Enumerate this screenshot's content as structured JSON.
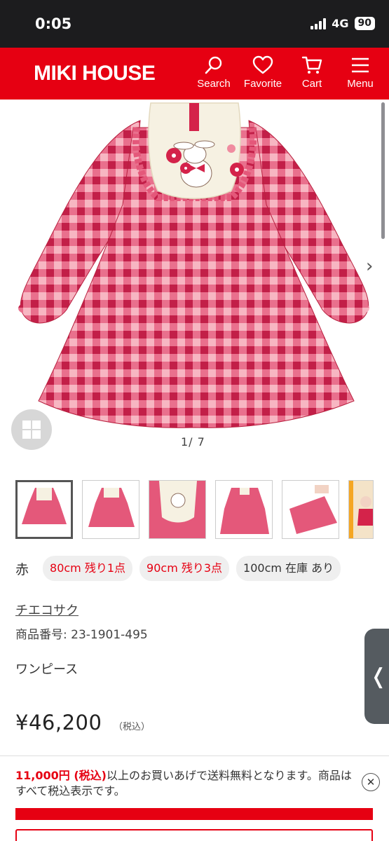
{
  "status_bar": {
    "time": "0:05",
    "network": "4G",
    "battery": "90"
  },
  "header": {
    "logo": "MIKI HOUSE",
    "nav": [
      {
        "label": "Search",
        "icon": "search-icon"
      },
      {
        "label": "Favorite",
        "icon": "heart-icon"
      },
      {
        "label": "Cart",
        "icon": "cart-icon"
      },
      {
        "label": "Menu",
        "icon": "hamburger-icon"
      }
    ]
  },
  "gallery": {
    "counter": "1/ 7"
  },
  "product": {
    "color_label": "赤",
    "sizes": [
      {
        "label": "80cm 残り1点",
        "status": "low"
      },
      {
        "label": "90cm 残り3点",
        "status": "low"
      },
      {
        "label": "100cm 在庫 あり",
        "status": "in-stock"
      }
    ],
    "brand": "チエコサク",
    "sku": "商品番号: 23-1901-495",
    "category": "ワンピース",
    "price": "¥46,200",
    "tax_note": "（税込）"
  },
  "banner": {
    "highlight": "11,000円 (税込)",
    "text": "以上のお買いあげで送料無料となります。商品はすべて税込表示です。",
    "close": "✕"
  },
  "colors": {
    "brand_red": "#e60012",
    "chip_bg": "#efefef",
    "dress_red": "#d93a5a",
    "dress_pink": "#f08ca0"
  }
}
